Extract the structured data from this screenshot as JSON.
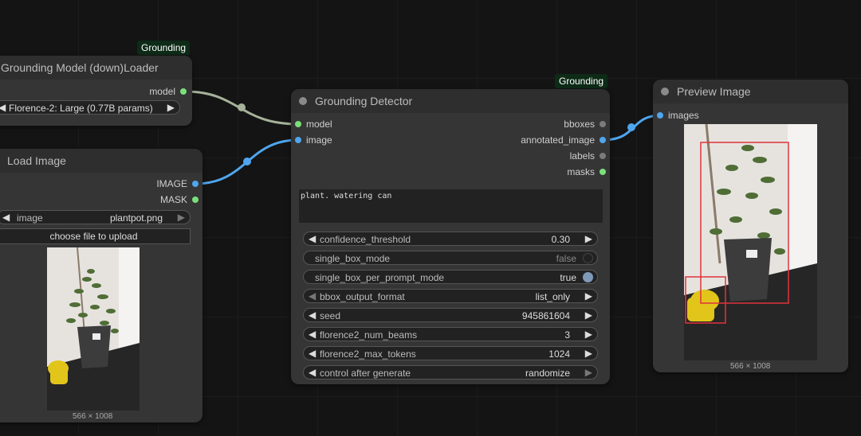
{
  "badges": {
    "loader": "Grounding",
    "detector": "Grounding"
  },
  "loader": {
    "title": "Grounding Model (down)Loader",
    "output_model": "model",
    "model_value": "Florence-2: Large (0.77B params)"
  },
  "load_image": {
    "title": "Load Image",
    "output_image": "IMAGE",
    "output_mask": "MASK",
    "image_label": "image",
    "image_value": "plantpot.png",
    "upload_button": "choose file to upload",
    "caption": "566 × 1008"
  },
  "detector": {
    "title": "Grounding Detector",
    "inputs": [
      "model",
      "image"
    ],
    "outputs": [
      "bboxes",
      "annotated_image",
      "labels",
      "masks"
    ],
    "prompt": "plant. watering can",
    "widgets": [
      {
        "label": "confidence_threshold",
        "value": "0.30"
      },
      {
        "label": "single_box_mode",
        "value": "false"
      },
      {
        "label": "single_box_per_prompt_mode",
        "value": "true"
      },
      {
        "label": "bbox_output_format",
        "value": "list_only"
      },
      {
        "label": "seed",
        "value": "945861604"
      },
      {
        "label": "florence2_num_beams",
        "value": "3"
      },
      {
        "label": "florence2_max_tokens",
        "value": "1024"
      },
      {
        "label": "control after generate",
        "value": "randomize"
      }
    ]
  },
  "preview": {
    "title": "Preview Image",
    "input_images": "images",
    "caption": "566 × 1008"
  },
  "colors": {
    "canvas": "#141414",
    "node": "#353535",
    "model_link": "#a6b29a",
    "image_link": "#4fa6ee",
    "bbox": "#e0323c"
  },
  "icons": {
    "arrow_left": "◀",
    "arrow_right": "▶"
  }
}
